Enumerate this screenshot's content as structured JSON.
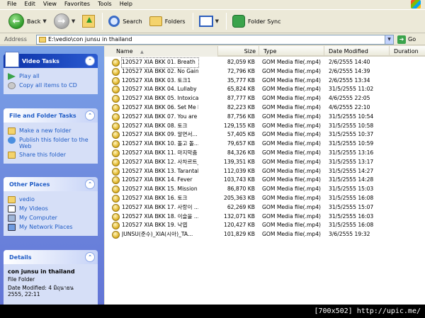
{
  "menu": {
    "items": [
      "File",
      "Edit",
      "View",
      "Favorites",
      "Tools",
      "Help"
    ]
  },
  "toolbar": {
    "back_label": "Back",
    "search_label": "Search",
    "folders_label": "Folders",
    "sync_label": "Folder Sync"
  },
  "address": {
    "label": "Address",
    "path": "E:\\vedio\\con junsu in thailand",
    "go_label": "Go"
  },
  "left": {
    "video_tasks": {
      "title": "Video Tasks",
      "items": [
        "Play all",
        "Copy all items to CD"
      ]
    },
    "file_folder_tasks": {
      "title": "File and Folder Tasks",
      "items": [
        "Make a new folder",
        "Publish this folder to the Web",
        "Share this folder"
      ]
    },
    "other_places": {
      "title": "Other Places",
      "items": [
        "vedio",
        "My Videos",
        "My Computer",
        "My Network Places"
      ]
    },
    "details": {
      "title": "Details",
      "name": "con junsu in thailand",
      "kind": "File Folder",
      "modified_line1": "Date Modified: 4 มิถุนายน",
      "modified_line2": "2555, 22:11"
    }
  },
  "filelist": {
    "columns": {
      "name": "Name",
      "size": "Size",
      "type": "Type",
      "date": "Date Modified",
      "duration": "Duration"
    },
    "sort_indicator": "▲",
    "rows": [
      {
        "name": "120527 XIA BKK 01. Breath",
        "size": "82,059 KB",
        "type": "GOM Media file(.mp4)",
        "date": "2/6/2555 14:40"
      },
      {
        "name": "120527 XIA BKK 02. No Gain",
        "size": "72,796 KB",
        "type": "GOM Media file(.mp4)",
        "date": "2/6/2555 14:39"
      },
      {
        "name": "120527 XIA BKK 03. 토크1",
        "size": "35,777 KB",
        "type": "GOM Media file(.mp4)",
        "date": "2/6/2555 13:34"
      },
      {
        "name": "120527 XIA BKK 04. Lullaby",
        "size": "65,824 KB",
        "type": "GOM Media file(.mp4)",
        "date": "31/5/2555 11:02"
      },
      {
        "name": "120527 XIA BKK 05. Intoxication",
        "size": "87,777 KB",
        "type": "GOM Media file(.mp4)",
        "date": "4/6/2555 22:05"
      },
      {
        "name": "120527 XIA BKK 06. Set Me F...",
        "size": "82,223 KB",
        "type": "GOM Media file(.mp4)",
        "date": "4/6/2555 22:10"
      },
      {
        "name": "120527 XIA BKK 07. You are s...",
        "size": "87,756 KB",
        "type": "GOM Media file(.mp4)",
        "date": "31/5/2555 10:54"
      },
      {
        "name": "120527 XIA BKK 08. 토크",
        "size": "129,155 KB",
        "type": "GOM Media file(.mp4)",
        "date": "31/5/2555 10:58"
      },
      {
        "name": "120527 XIA BKK 09. 알면서...",
        "size": "57,405 KB",
        "type": "GOM Media file(.mp4)",
        "date": "31/5/2555 10:37"
      },
      {
        "name": "120527 XIA BKK 10. 돌고 돌...",
        "size": "79,657 KB",
        "type": "GOM Media file(.mp4)",
        "date": "31/5/2555 10:59"
      },
      {
        "name": "120527 XIA BKK 11. 마지막춤",
        "size": "84,326 KB",
        "type": "GOM Media file(.mp4)",
        "date": "31/5/2555 13:16"
      },
      {
        "name": "120527 XIA BKK 12. 사차르트_",
        "size": "139,351 KB",
        "type": "GOM Media file(.mp4)",
        "date": "31/5/2555 13:17"
      },
      {
        "name": "120527 XIA BKK 13. Tarantall...",
        "size": "112,039 KB",
        "type": "GOM Media file(.mp4)",
        "date": "31/5/2555 14:27"
      },
      {
        "name": "120527 XIA BKK 14. Fever",
        "size": "103,743 KB",
        "type": "GOM Media file(.mp4)",
        "date": "31/5/2555 14:28"
      },
      {
        "name": "120527 XIA BKK 15. Mission",
        "size": "86,870 KB",
        "type": "GOM Media file(.mp4)",
        "date": "31/5/2555 15:03"
      },
      {
        "name": "120527 XIA BKK 16. 토크",
        "size": "205,363 KB",
        "type": "GOM Media file(.mp4)",
        "date": "31/5/2555 16:08"
      },
      {
        "name": "120527 XIA BKK 17. 사랑이 ...",
        "size": "62,269 KB",
        "type": "GOM Media file(.mp4)",
        "date": "31/5/2555 15:07"
      },
      {
        "name": "120527 XIA BKK 18. 이슬을 ...",
        "size": "132,071 KB",
        "type": "GOM Media file(.mp4)",
        "date": "31/5/2555 16:03"
      },
      {
        "name": "120527 XIA BKK 19. 낙엽",
        "size": "120,427 KB",
        "type": "GOM Media file(.mp4)",
        "date": "31/5/2555 16:08"
      },
      {
        "name": "JUNSU(준수)_XIA(시아)_TA...",
        "size": "101,829 KB",
        "type": "GOM Media file(.mp4)",
        "date": "3/6/2555 19:32"
      }
    ]
  },
  "caption": "[700x502] http://upic.me/"
}
